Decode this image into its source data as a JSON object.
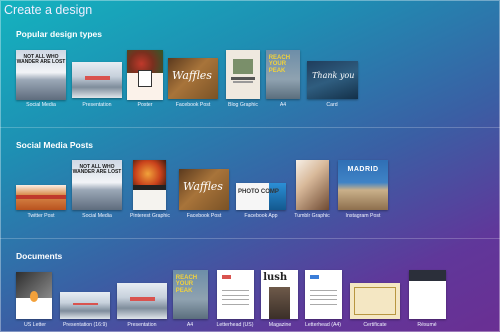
{
  "page": {
    "title": "Create a design"
  },
  "sections": [
    {
      "title": "Popular design types",
      "items": [
        {
          "label": "Social Media",
          "text": "NOT ALL WHO WANDER ARE LOST"
        },
        {
          "label": "Presentation"
        },
        {
          "label": "Poster"
        },
        {
          "label": "Facebook Post",
          "text": "Waffles"
        },
        {
          "label": "Blog Graphic"
        },
        {
          "label": "A4",
          "text": "REACH YOUR PEAK"
        },
        {
          "label": "Card",
          "text": "Thank you"
        }
      ]
    },
    {
      "title": "Social Media Posts",
      "items": [
        {
          "label": "Twitter Post"
        },
        {
          "label": "Social Media",
          "text": "NOT ALL WHO WANDER ARE LOST"
        },
        {
          "label": "Pinterest Graphic"
        },
        {
          "label": "Facebook Post",
          "text": "Waffles"
        },
        {
          "label": "Facebook App",
          "text": "PHOTO COMP"
        },
        {
          "label": "Tumblr Graphic"
        },
        {
          "label": "Instagram Post",
          "text": "MADRID"
        }
      ]
    },
    {
      "title": "Documents",
      "items": [
        {
          "label": "US Letter"
        },
        {
          "label": "Presentation (16:9)"
        },
        {
          "label": "Presentation"
        },
        {
          "label": "A4",
          "text": "REACH YOUR PEAK"
        },
        {
          "label": "Letterhead (US)"
        },
        {
          "label": "Magazine",
          "text": "lush"
        },
        {
          "label": "Letterhead (A4)"
        },
        {
          "label": "Certificate"
        },
        {
          "label": "Résumé"
        }
      ]
    }
  ]
}
